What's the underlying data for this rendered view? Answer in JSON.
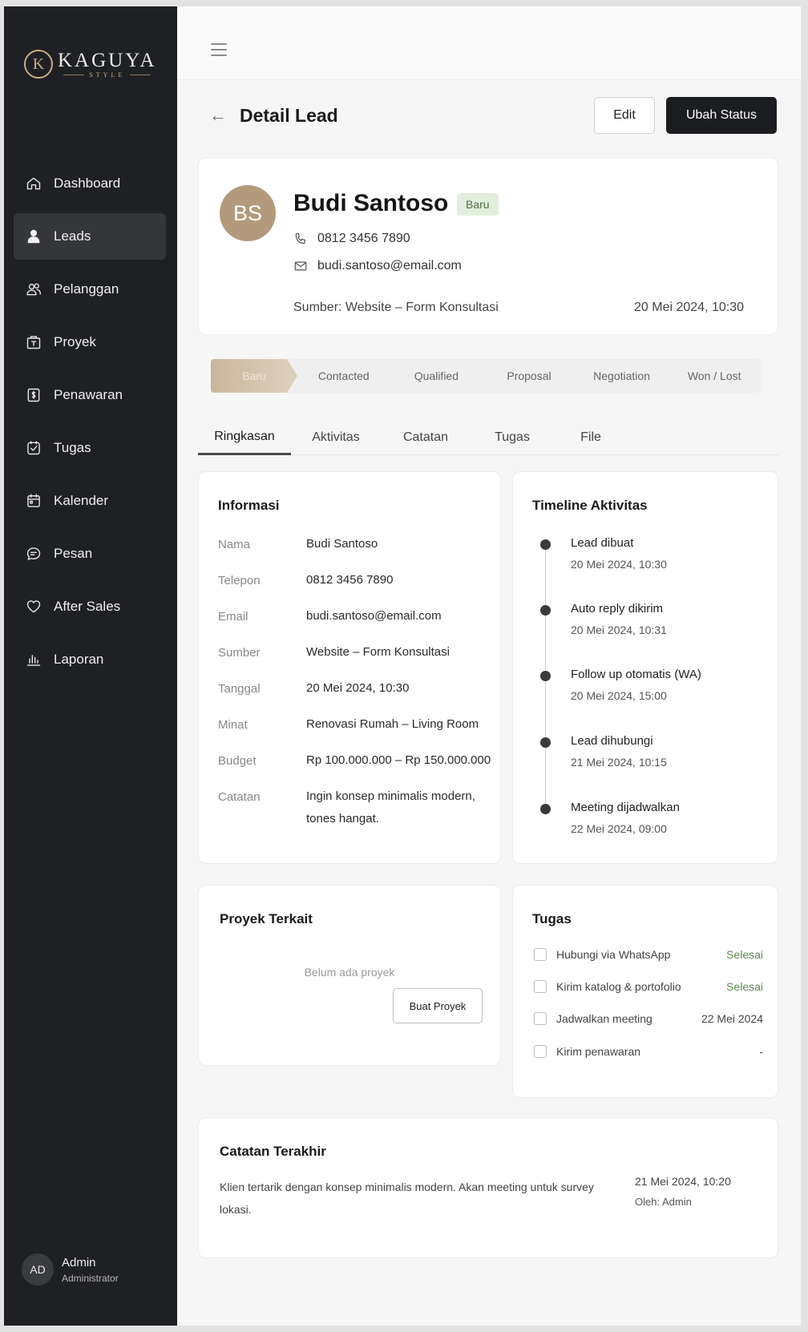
{
  "brand": {
    "mark": "K",
    "name": "KAGUYA",
    "sub": "STYLE"
  },
  "sidebar": {
    "items": [
      {
        "label": "Dashboard",
        "icon": "home-icon"
      },
      {
        "label": "Leads",
        "icon": "users-icon"
      },
      {
        "label": "Pelanggan",
        "icon": "customers-icon"
      },
      {
        "label": "Proyek",
        "icon": "project-icon"
      },
      {
        "label": "Penawaran",
        "icon": "offer-icon"
      },
      {
        "label": "Tugas",
        "icon": "task-icon"
      },
      {
        "label": "Kalender",
        "icon": "calendar-icon"
      },
      {
        "label": "Pesan",
        "icon": "message-icon"
      },
      {
        "label": "After Sales",
        "icon": "heart-icon"
      },
      {
        "label": "Laporan",
        "icon": "chart-icon"
      }
    ],
    "active": "Leads"
  },
  "user": {
    "initials": "AD",
    "name": "Admin",
    "role": "Administrator"
  },
  "header": {
    "title": "Detail Lead",
    "edit_label": "Edit",
    "status_label": "Ubah Status"
  },
  "lead": {
    "initials": "BS",
    "name": "Budi Santoso",
    "badge": "Baru",
    "phone": "0812 3456 7890",
    "email": "budi.santoso@email.com",
    "source": "Sumber: Website – Form Konsultasi",
    "date": "20 Mei 2024, 10:30"
  },
  "stages": [
    "Baru",
    "Contacted",
    "Qualified",
    "Proposal",
    "Negotiation",
    "Won / Lost"
  ],
  "tabs": [
    "Ringkasan",
    "Aktivitas",
    "Catatan",
    "Tugas",
    "File"
  ],
  "info": {
    "title": "Informasi",
    "rows": [
      {
        "label": "Nama",
        "value": "Budi Santoso"
      },
      {
        "label": "Telepon",
        "value": "0812 3456 7890"
      },
      {
        "label": "Email",
        "value": "budi.santoso@email.com"
      },
      {
        "label": "Sumber",
        "value": "Website – Form Konsultasi"
      },
      {
        "label": "Tanggal",
        "value": "20 Mei 2024, 10:30"
      },
      {
        "label": "Minat",
        "value": "Renovasi Rumah – Living Room"
      },
      {
        "label": "Budget",
        "value": "Rp 100.000.000 – Rp 150.000.000"
      },
      {
        "label": "Catatan",
        "value": "Ingin konsep minimalis modern, tones hangat."
      }
    ]
  },
  "timeline": {
    "title": "Timeline Aktivitas",
    "items": [
      {
        "title": "Lead dibuat",
        "date": "20 Mei 2024, 10:30"
      },
      {
        "title": "Auto reply dikirim",
        "date": "20 Mei 2024, 10:31"
      },
      {
        "title": "Follow up otomatis (WA)",
        "date": "20 Mei 2024, 15:00"
      },
      {
        "title": "Lead dihubungi",
        "date": "21 Mei 2024, 10:15"
      },
      {
        "title": "Meeting dijadwalkan",
        "date": "22 Mei 2024, 09:00"
      }
    ]
  },
  "proyek": {
    "title": "Proyek Terkait",
    "empty": "Belum ada proyek",
    "button": "Buat Proyek"
  },
  "tugas": {
    "title": "Tugas",
    "items": [
      {
        "label": "Hubungi via WhatsApp",
        "status": "Selesai"
      },
      {
        "label": "Kirim katalog & portofolio",
        "status": "Selesai"
      },
      {
        "label": "Jadwalkan meeting",
        "status": "22 Mei 2024"
      },
      {
        "label": "Kirim penawaran",
        "status": "-"
      }
    ]
  },
  "catatan": {
    "title": "Catatan Terakhir",
    "text": "Klien tertarik dengan konsep minimalis modern. Akan meeting untuk survey lokasi.",
    "date": "21 Mei 2024, 10:20",
    "by": "Oleh: Admin"
  },
  "colors": {
    "sidebar": "#1f2023",
    "accent": "#b39a7d",
    "success": "#5e8a52",
    "badge_bg": "#e2eedd"
  }
}
